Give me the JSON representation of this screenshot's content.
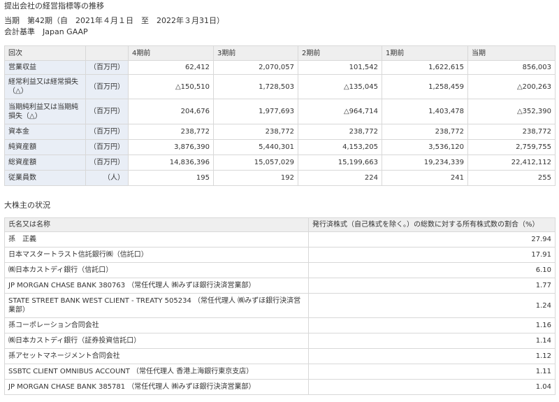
{
  "header": {
    "title": "提出会社の経営指標等の推移",
    "period": "当期　第42期（自　2021年４月１日　至　2022年３月31日）",
    "standard": "会計基準　Japan GAAP"
  },
  "performance": {
    "columns": [
      "回次",
      "",
      "4期前",
      "3期前",
      "2期前",
      "1期前",
      "当期"
    ],
    "rows": [
      {
        "label": "営業収益",
        "unit": "（百万円）",
        "values": [
          "62,412",
          "2,070,057",
          "101,542",
          "1,622,615",
          "856,003"
        ]
      },
      {
        "label": "経常利益又は経常損失（△）",
        "unit": "（百万円）",
        "values": [
          "△150,510",
          "1,728,503",
          "△135,045",
          "1,258,459",
          "△200,263"
        ]
      },
      {
        "label": "当期純利益又は当期純損失（△）",
        "unit": "（百万円）",
        "values": [
          "204,676",
          "1,977,693",
          "△964,714",
          "1,403,478",
          "△352,390"
        ]
      },
      {
        "label": "資本金",
        "unit": "（百万円）",
        "values": [
          "238,772",
          "238,772",
          "238,772",
          "238,772",
          "238,772"
        ]
      },
      {
        "label": "純資産額",
        "unit": "（百万円）",
        "values": [
          "3,876,390",
          "5,440,301",
          "4,153,205",
          "3,536,120",
          "2,759,755"
        ]
      },
      {
        "label": "総資産額",
        "unit": "（百万円）",
        "values": [
          "14,836,396",
          "15,057,029",
          "15,199,663",
          "19,234,339",
          "22,412,112"
        ]
      },
      {
        "label": "従業員数",
        "unit": "（人）",
        "values": [
          "195",
          "192",
          "224",
          "241",
          "255"
        ]
      }
    ]
  },
  "shareholders": {
    "title": "大株主の状況",
    "columns": [
      "氏名又は名称",
      "発行済株式（自己株式を除く。）の総数に対する所有株式数の割合（%）"
    ],
    "rows": [
      {
        "name": "孫　正義",
        "ratio": "27.94"
      },
      {
        "name": "日本マスタートラスト信託銀行㈱（信託口）",
        "ratio": "17.91"
      },
      {
        "name": "㈱日本カストディ銀行（信託口）",
        "ratio": "6.10"
      },
      {
        "name": "JP MORGAN CHASE BANK 380763 （常任代理人 ㈱みずほ銀行決済営業部）",
        "ratio": "1.77"
      },
      {
        "name": "STATE STREET BANK WEST CLIENT - TREATY 505234 （常任代理人 ㈱みずほ銀行決済営業部）",
        "ratio": "1.24"
      },
      {
        "name": "孫コーポレーション合同会社",
        "ratio": "1.16"
      },
      {
        "name": "㈱日本カストディ銀行（証券投資信託口）",
        "ratio": "1.14"
      },
      {
        "name": "孫アセットマネージメント合同会社",
        "ratio": "1.12"
      },
      {
        "name": "SSBTC CLIENT OMNIBUS ACCOUNT （常任代理人 香港上海銀行東京支店）",
        "ratio": "1.11"
      },
      {
        "name": "JP MORGAN CHASE BANK 385781 （常任代理人 ㈱みずほ銀行決済営業部）",
        "ratio": "1.04"
      }
    ]
  }
}
